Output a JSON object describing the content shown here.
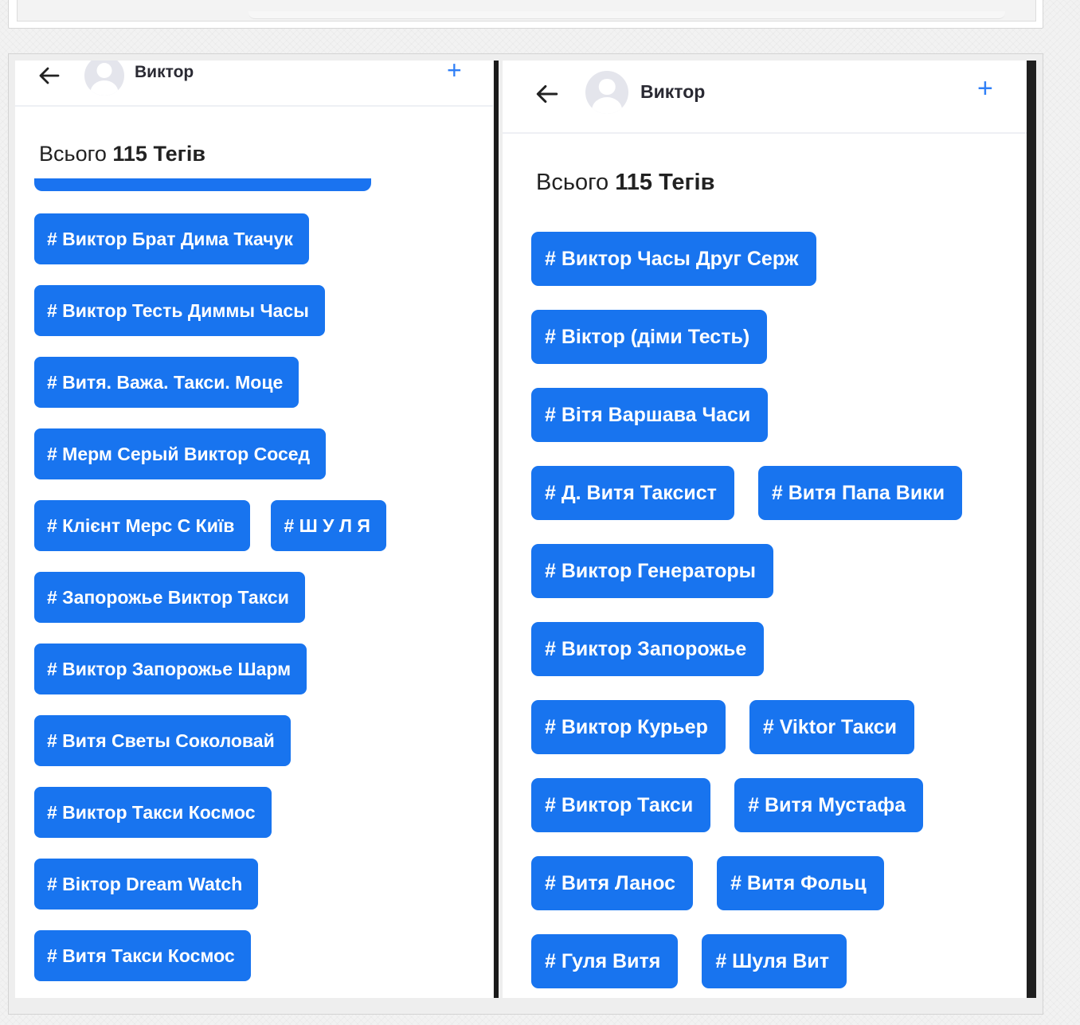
{
  "left_panel": {
    "header": {
      "name": "Виктор"
    },
    "total": {
      "prefix": "Всього",
      "count": "115",
      "suffix": "Тегів"
    },
    "tag_rows": [
      [
        "# Виктор Брат Дима Ткачук"
      ],
      [
        "# Виктор Тесть Диммы Часы"
      ],
      [
        "# Витя. Важа. Такси. Моце"
      ],
      [
        "# Мерм Серый Виктор Сосед"
      ],
      [
        "# Клієнт Мерс С Київ",
        "# Ш У Л Я"
      ],
      [
        "# Запорожье Виктор Такси"
      ],
      [
        "# Виктор Запорожье Шарм"
      ],
      [
        "# Витя Светы Соколовай"
      ],
      [
        "# Виктор Такси Космос"
      ],
      [
        "# Віктор Dream Watch"
      ],
      [
        "# Витя Такси Космос"
      ]
    ]
  },
  "right_panel": {
    "header": {
      "name": "Виктор"
    },
    "total": {
      "prefix": "Всього",
      "count": "115",
      "suffix": "Тегів"
    },
    "tag_rows": [
      [
        "# Виктор Часы Друг Серж"
      ],
      [
        "# Віктор (діми Тесть)"
      ],
      [
        "# Вітя Варшава Часи"
      ],
      [
        "# Д. Витя Таксист",
        "# Витя Папа Вики"
      ],
      [
        "# Виктор Генераторы"
      ],
      [
        "# Виктор Запорожье"
      ],
      [
        "# Виктор Курьер",
        "# Viktor Такси"
      ],
      [
        "# Виктор Такси",
        "# Витя Мустафа"
      ],
      [
        "# Витя Ланос",
        "# Витя Фольц"
      ],
      [
        "# Гуля Витя",
        "# Шуля Вит"
      ]
    ]
  },
  "colors": {
    "tag_background": "#1874ef",
    "accent": "#2f7ff7"
  },
  "icons": {
    "back": "arrow-left-icon",
    "add": "plus-icon",
    "avatar": "user-avatar-icon"
  }
}
